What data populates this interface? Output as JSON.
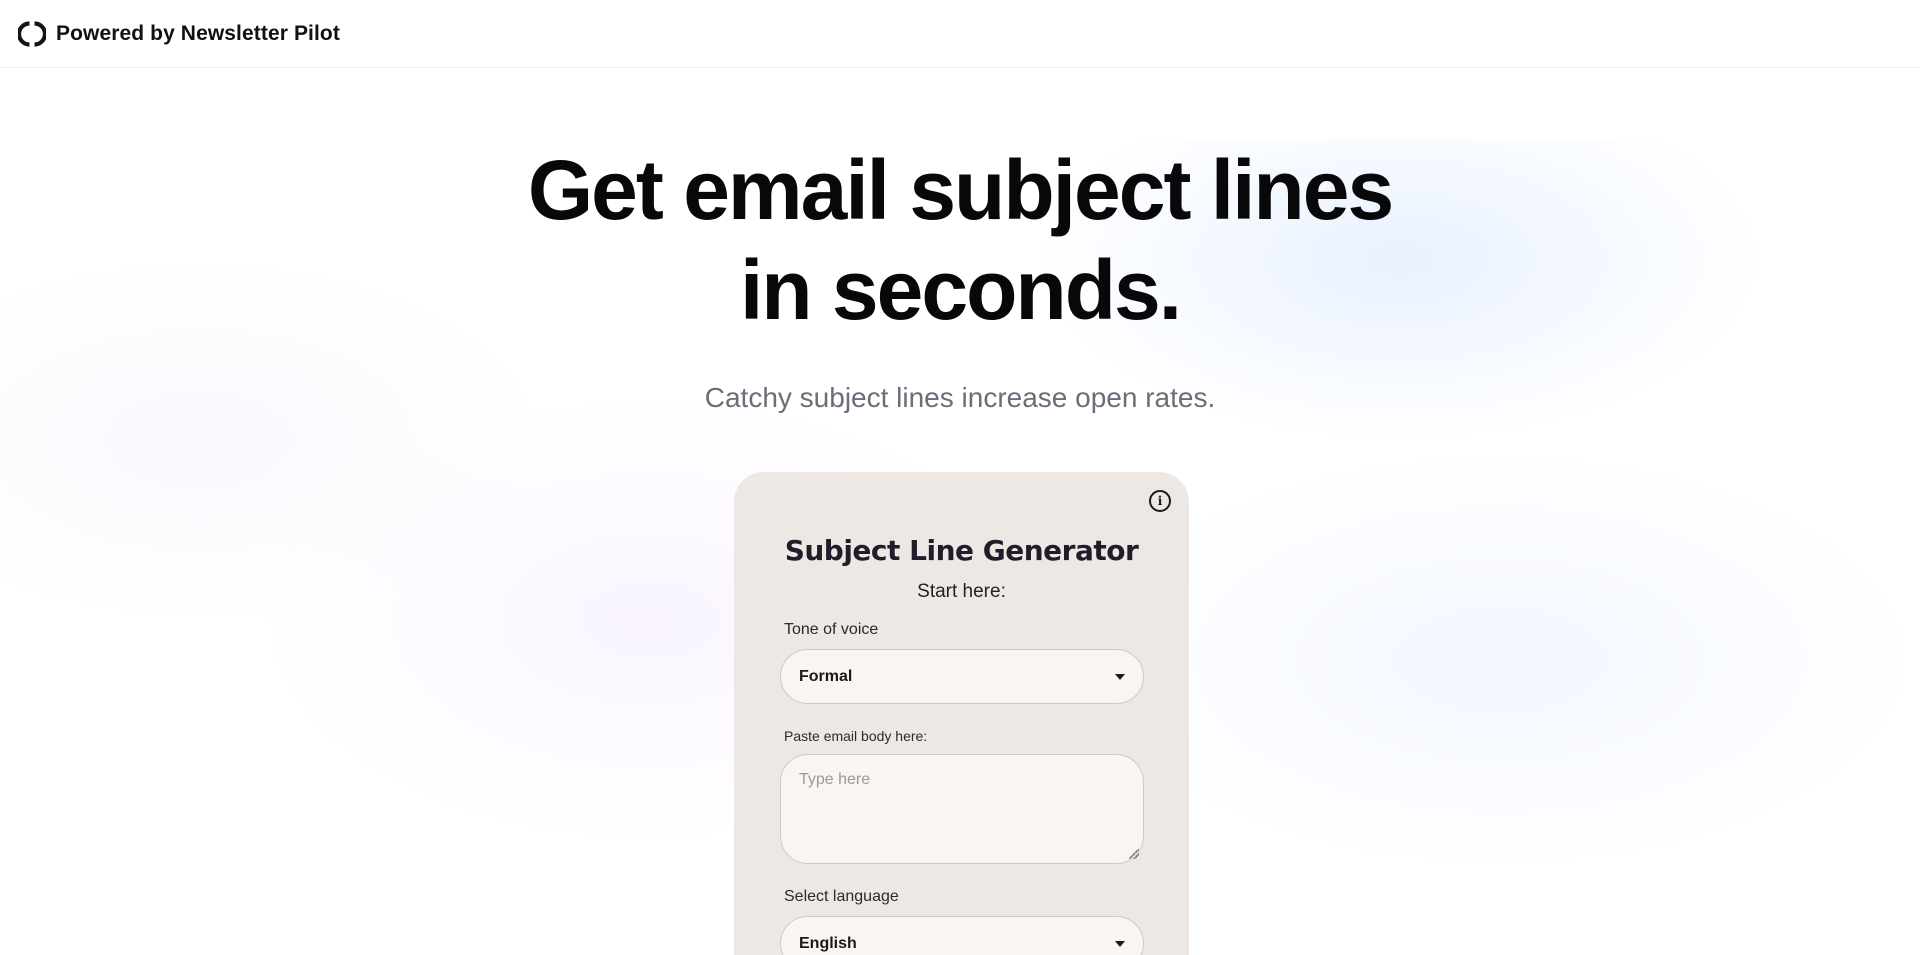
{
  "header": {
    "brand_text": "Powered by Newsletter Pilot",
    "icon": "ring-logo-icon"
  },
  "hero": {
    "title_line1": "Get email subject lines",
    "title_line2": "in seconds.",
    "subtitle": "Catchy subject lines increase open rates."
  },
  "card": {
    "title": "Subject Line Generator",
    "start_text": "Start here:",
    "info_icon": "info-icon",
    "tone": {
      "label": "Tone of voice",
      "value": "Formal"
    },
    "email_body": {
      "label": "Paste email body here:",
      "placeholder": "Type here",
      "value": ""
    },
    "language": {
      "label": "Select language",
      "value": "English"
    }
  },
  "colors": {
    "card_bg": "#ede8e4",
    "field_bg": "#f8f5f2",
    "title_color": "#241a2c",
    "subtitle_color": "#6b6e78"
  }
}
